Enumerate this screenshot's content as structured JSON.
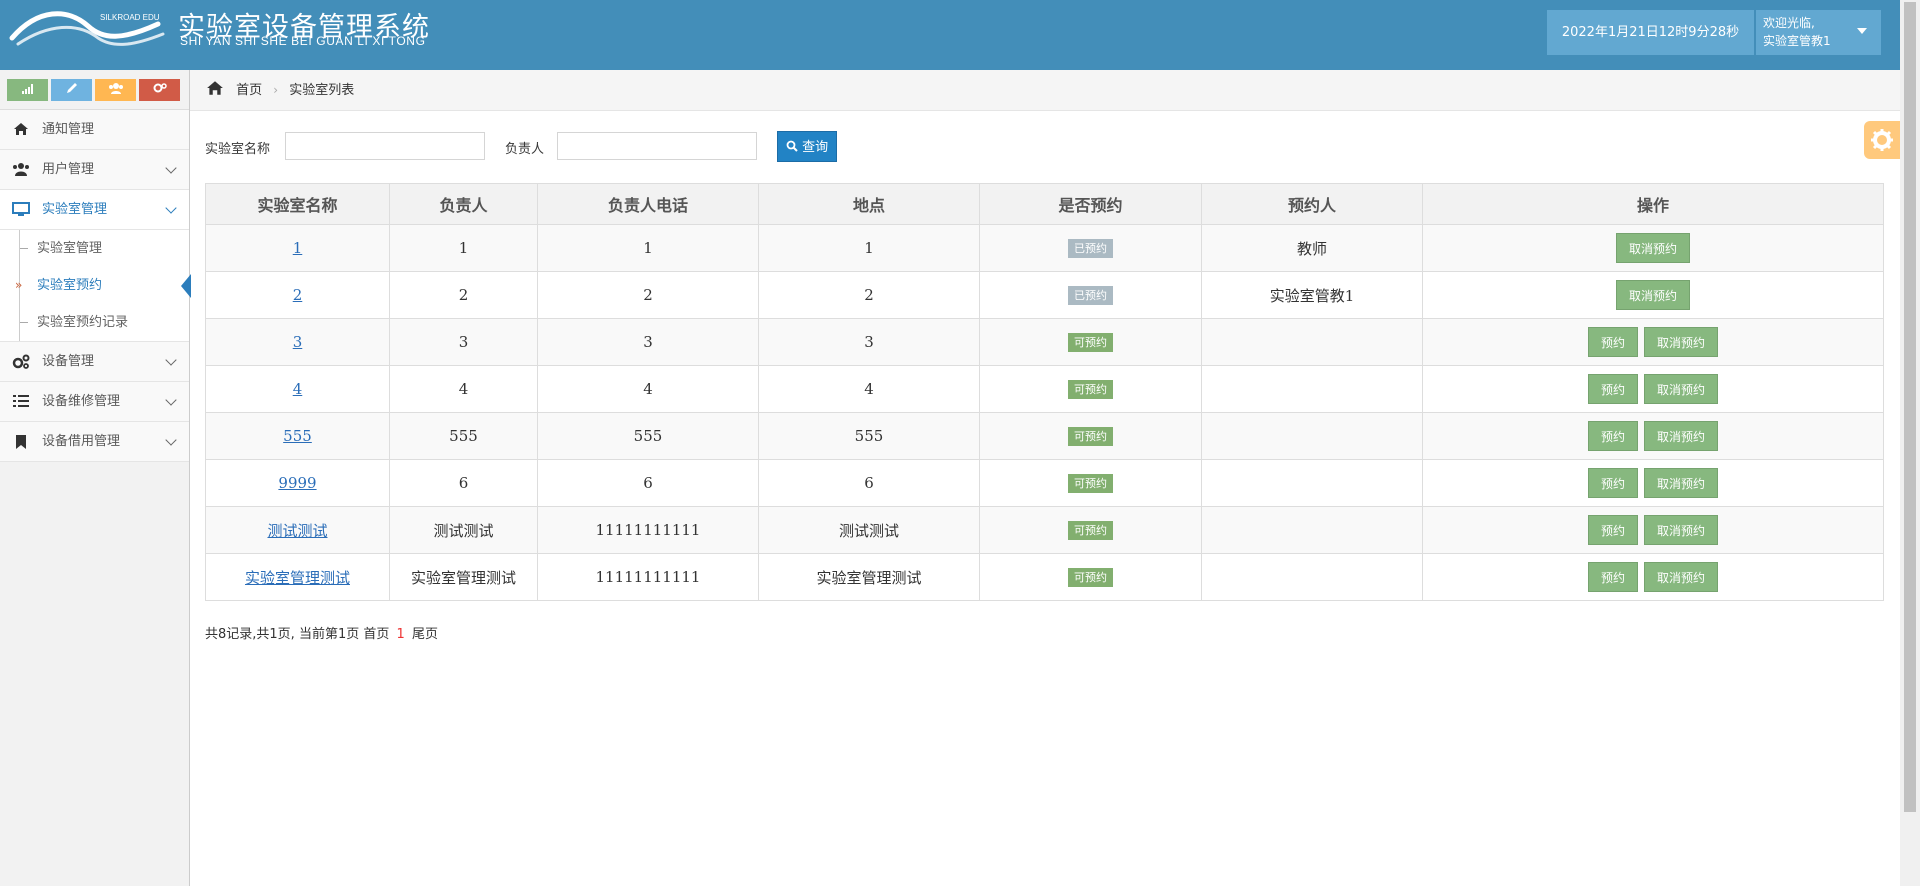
{
  "header": {
    "logo_text": "SILKROAD EDU",
    "title": "实验室设备管理系统",
    "subtitle": "SHI YAN SHI SHE BEI GUAN LI XI TONG",
    "datetime": "2022年1月21日12时9分28秒",
    "welcome": "欢迎光临,",
    "username": "实验室管教1"
  },
  "shortcuts": [
    {
      "icon": "signal-icon",
      "color": "#87b87f"
    },
    {
      "icon": "pencil-icon",
      "color": "#6fb3e0"
    },
    {
      "icon": "group-icon",
      "color": "#ffb752"
    },
    {
      "icon": "cogs-icon",
      "color": "#d15b47"
    }
  ],
  "sidebar": {
    "items": [
      {
        "label": "通知管理",
        "icon": "home-icon"
      },
      {
        "label": "用户管理",
        "icon": "users-icon"
      },
      {
        "label": "实验室管理",
        "icon": "desktop-icon"
      },
      {
        "label": "设备管理",
        "icon": "cogs-icon"
      },
      {
        "label": "设备维修管理",
        "icon": "list-icon"
      },
      {
        "label": "设备借用管理",
        "icon": "bookmark-icon"
      }
    ],
    "lab_submenu": [
      {
        "label": "实验室管理"
      },
      {
        "label": "实验室预约"
      },
      {
        "label": "实验室预约记录"
      }
    ]
  },
  "breadcrumb": {
    "home": "首页",
    "current": "实验室列表"
  },
  "search": {
    "name_label": "实验室名称",
    "name_value": "",
    "owner_label": "负责人",
    "owner_value": "",
    "button_label": "查询"
  },
  "table": {
    "headers": [
      "实验室名称",
      "负责人",
      "负责人电话",
      "地点",
      "是否预约",
      "预约人",
      "操作"
    ],
    "rows": [
      {
        "name": "1",
        "owner": "1",
        "phone": "1",
        "location": "1",
        "status": "已预约",
        "booker": "教师"
      },
      {
        "name": "2",
        "owner": "2",
        "phone": "2",
        "location": "2",
        "status": "已预约",
        "booker": "实验室管教1"
      },
      {
        "name": "3",
        "owner": "3",
        "phone": "3",
        "location": "3",
        "status": "可预约",
        "booker": ""
      },
      {
        "name": "4",
        "owner": "4",
        "phone": "4",
        "location": "4",
        "status": "可预约",
        "booker": ""
      },
      {
        "name": "555",
        "owner": "555",
        "phone": "555",
        "location": "555",
        "status": "可预约",
        "booker": ""
      },
      {
        "name": "9999",
        "owner": "6",
        "phone": "6",
        "location": "6",
        "status": "可预约",
        "booker": ""
      },
      {
        "name": "测试测试",
        "owner": "测试测试",
        "phone": "11111111111",
        "location": "测试测试",
        "status": "可预约",
        "booker": ""
      },
      {
        "name": "实验室管理测试",
        "owner": "实验室管理测试",
        "phone": "11111111111",
        "location": "实验室管理测试",
        "status": "可预约",
        "booker": ""
      }
    ],
    "book_label": "预约",
    "cancel_label": "取消预约"
  },
  "pager": {
    "summary": "共8记录,共1页, 当前第1页",
    "first": "首页",
    "current_page": "1",
    "last": "尾页"
  },
  "colors": {
    "header_bg": "#438eb9",
    "accent": "#2b7dbc",
    "badge_booked": "#abbac3",
    "badge_available": "#82af6f",
    "op_button": "#87b87f",
    "search_button": "#2283c5"
  }
}
